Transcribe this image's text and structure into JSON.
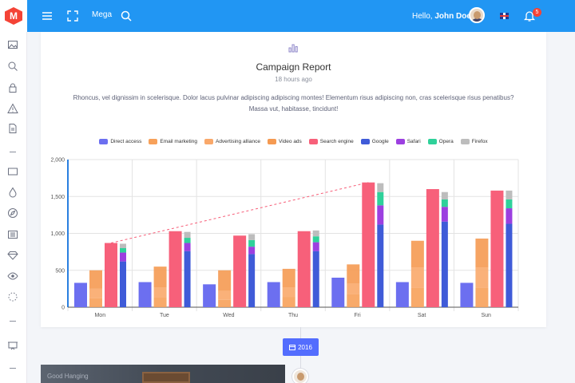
{
  "topbar": {
    "logo_letter": "M",
    "mega_label": "Mega",
    "hello_prefix": "Hello,",
    "user_name": "John Doe",
    "notification_count": "5"
  },
  "card": {
    "title": "Campaign Report",
    "time": "18 hours ago",
    "description": "Rhoncus, vel dignissim in scelerisque. Dolor lacus pulvinar adipiscing adipiscing montes! Elementum risus adipiscing non, cras scelerisque risus penatibus? Massa vut, habitasse, tincidunt!"
  },
  "timeline": {
    "year_label": "2016",
    "photo_caption": "Good Hanging"
  },
  "chart_data": {
    "type": "bar",
    "categories": [
      "Mon",
      "Tue",
      "Wed",
      "Thu",
      "Fri",
      "Sat",
      "Sun"
    ],
    "ylim": [
      0,
      2000
    ],
    "yticks": [
      "0",
      "500",
      "1,000",
      "1,500",
      "2,000"
    ],
    "ytick_values": [
      0,
      500,
      1000,
      1500,
      2000
    ],
    "grid": true,
    "legend_position": "top",
    "series": [
      {
        "name": "Direct access",
        "color": "#6c6ff0",
        "stack": "a",
        "values": [
          330,
          340,
          310,
          340,
          400,
          340,
          330
        ]
      },
      {
        "name": "Email marketing",
        "color": "#f7a15a",
        "stack": "b",
        "values": [
          120,
          130,
          100,
          140,
          180,
          260,
          260
        ]
      },
      {
        "name": "Advertising alliance",
        "color": "#f9a86a",
        "stack": "b",
        "values": [
          130,
          140,
          120,
          130,
          140,
          280,
          280
        ]
      },
      {
        "name": "Video ads",
        "color": "#f59a52",
        "stack": "b",
        "values": [
          250,
          280,
          280,
          250,
          260,
          360,
          390
        ]
      },
      {
        "name": "Search engine",
        "color": "#f7607a",
        "stack": "c",
        "values": [
          870,
          1030,
          970,
          1030,
          1690,
          1600,
          1580
        ]
      },
      {
        "name": "Google",
        "color": "#3f5bd8",
        "stack": "d",
        "values": [
          620,
          760,
          720,
          760,
          1120,
          1160,
          1130
        ]
      },
      {
        "name": "Safari",
        "color": "#9c3fe0",
        "stack": "d",
        "values": [
          120,
          110,
          100,
          120,
          260,
          200,
          210
        ]
      },
      {
        "name": "Opera",
        "color": "#2fd19a",
        "stack": "d",
        "values": [
          60,
          70,
          90,
          80,
          180,
          100,
          120
        ]
      },
      {
        "name": "Firefox",
        "color": "#bdbdbd",
        "stack": "d",
        "values": [
          60,
          80,
          80,
          80,
          120,
          100,
          120
        ]
      }
    ],
    "trend_line": {
      "from": "Mon",
      "to": "Fri",
      "values": [
        870,
        1690
      ],
      "color": "#f7607a"
    }
  }
}
